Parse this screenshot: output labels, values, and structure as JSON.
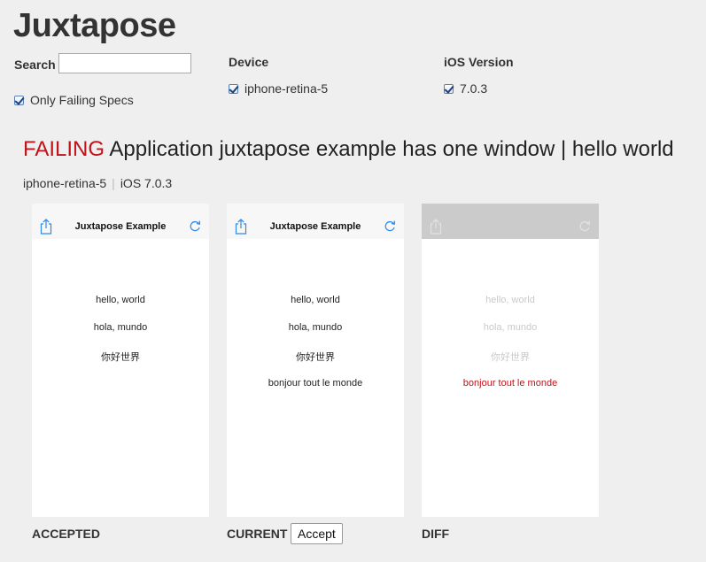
{
  "app": {
    "title": "Juxtapose"
  },
  "filters": {
    "search_label": "Search",
    "search_value": "",
    "only_failing_label": "Only Failing Specs",
    "device_heading": "Device",
    "device_option": "iphone-retina-5",
    "ios_heading": "iOS Version",
    "ios_option": "7.0.3"
  },
  "spec": {
    "status": "FAILING",
    "name": "Application juxtapose example has one window | hello world",
    "device": "iphone-retina-5",
    "ios": "iOS 7.0.3"
  },
  "screens": {
    "nav_title": "Juxtapose Example",
    "accepted_lines": [
      "hello, world",
      "hola, mundo",
      "你好世界"
    ],
    "current_lines": [
      "hello, world",
      "hola, mundo",
      "你好世界",
      "bonjour tout le monde"
    ],
    "diff_lines": [
      "hello, world",
      "hola, mundo",
      "你好世界",
      "bonjour tout le monde"
    ]
  },
  "captions": {
    "accepted": "ACCEPTED",
    "current": "CURRENT",
    "diff": "DIFF",
    "accept_button": "Accept"
  },
  "colors": {
    "failing": "#c0131b",
    "ios_blue": "#2f8bea",
    "diff_changed": "#c0131b"
  },
  "icons": {
    "share": "share-icon",
    "refresh": "refresh-icon"
  }
}
